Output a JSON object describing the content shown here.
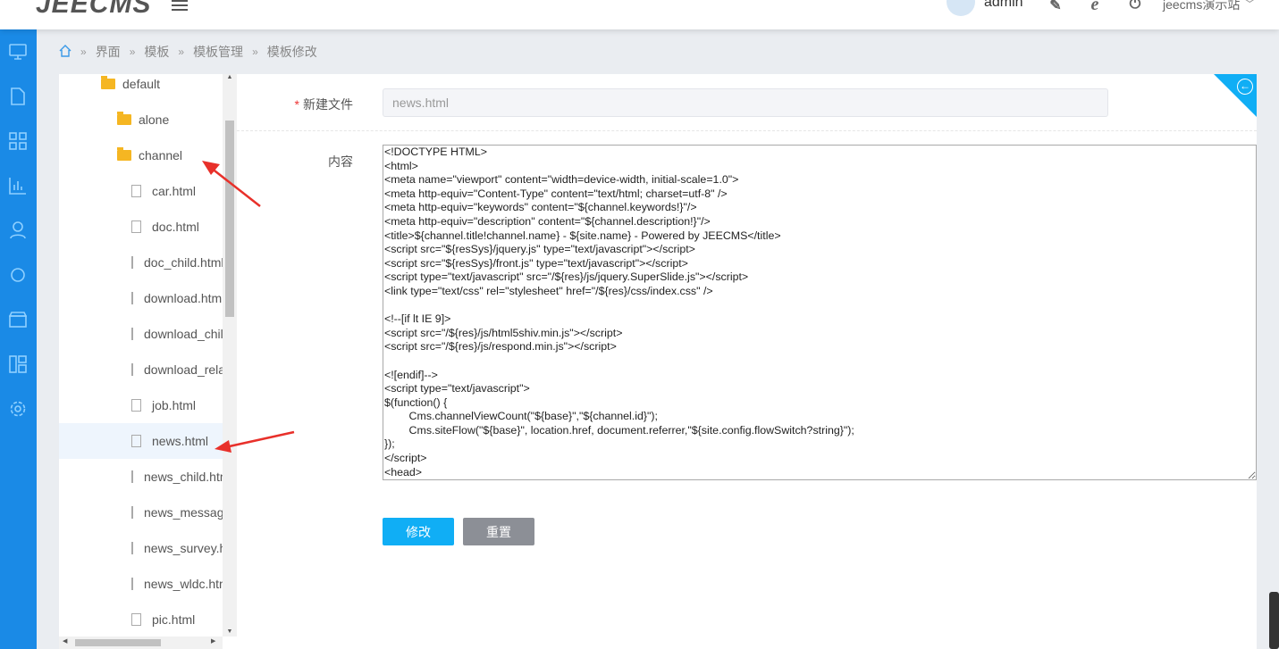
{
  "header": {
    "logo": "JEECMS",
    "user": "admin",
    "site": "jeecms演示站"
  },
  "breadcrumb": [
    "界面",
    "模板",
    "模板管理",
    "模板修改"
  ],
  "tree": [
    {
      "label": "default",
      "type": "folder-open",
      "level": 0
    },
    {
      "label": "alone",
      "type": "folder",
      "level": 1
    },
    {
      "label": "channel",
      "type": "folder-open",
      "level": 1
    },
    {
      "label": "car.html",
      "type": "file"
    },
    {
      "label": "doc.html",
      "type": "file"
    },
    {
      "label": "doc_child.html",
      "type": "file"
    },
    {
      "label": "download.html",
      "type": "file"
    },
    {
      "label": "download_child.html",
      "type": "file"
    },
    {
      "label": "download_relate.html",
      "type": "file"
    },
    {
      "label": "job.html",
      "type": "file"
    },
    {
      "label": "news.html",
      "type": "file",
      "selected": true
    },
    {
      "label": "news_child.html",
      "type": "file"
    },
    {
      "label": "news_message.html",
      "type": "file"
    },
    {
      "label": "news_survey.html",
      "type": "file"
    },
    {
      "label": "news_wldc.html",
      "type": "file"
    },
    {
      "label": "pic.html",
      "type": "file"
    }
  ],
  "form": {
    "filename_label": "新建文件",
    "filename_value": "news.html",
    "content_label": "内容",
    "content": "<!DOCTYPE HTML>\n<html>\n<meta name=\"viewport\" content=\"width=device-width, initial-scale=1.0\">\n<meta http-equiv=\"Content-Type\" content=\"text/html; charset=utf-8\" />\n<meta http-equiv=\"keywords\" content=\"${channel.keywords!}\"/>\n<meta http-equiv=\"description\" content=\"${channel.description!}\"/>\n<title>${channel.title!channel.name} - ${site.name} - Powered by JEECMS</title>\n<script src=\"${resSys}/jquery.js\" type=\"text/javascript\"></script>\n<script src=\"${resSys}/front.js\" type=\"text/javascript\"></script>\n<script type=\"text/javascript\" src=\"/${res}/js/jquery.SuperSlide.js\"></script>\n<link type=\"text/css\" rel=\"stylesheet\" href=\"/${res}/css/index.css\" />\n\n<!--[if lt IE 9]>\n<script src=\"/${res}/js/html5shiv.min.js\"></script>\n<script src=\"/${res}/js/respond.min.js\"></script>\n\n<![endif]-->\n<script type=\"text/javascript\">\n$(function() {\n\tCms.channelViewCount(\"${base}\",\"${channel.id}\");\n\tCms.siteFlow(\"${base}\", location.href, document.referrer,\"${site.config.flowSwitch?string}\");\n});\n</script>\n<head>\n<body>",
    "submit": "修改",
    "reset": "重置"
  },
  "colors": {
    "sidebar": "#1a8ae6",
    "primary": "#10aef5",
    "reset": "#8c8f96",
    "arrow": "#e8302a"
  }
}
